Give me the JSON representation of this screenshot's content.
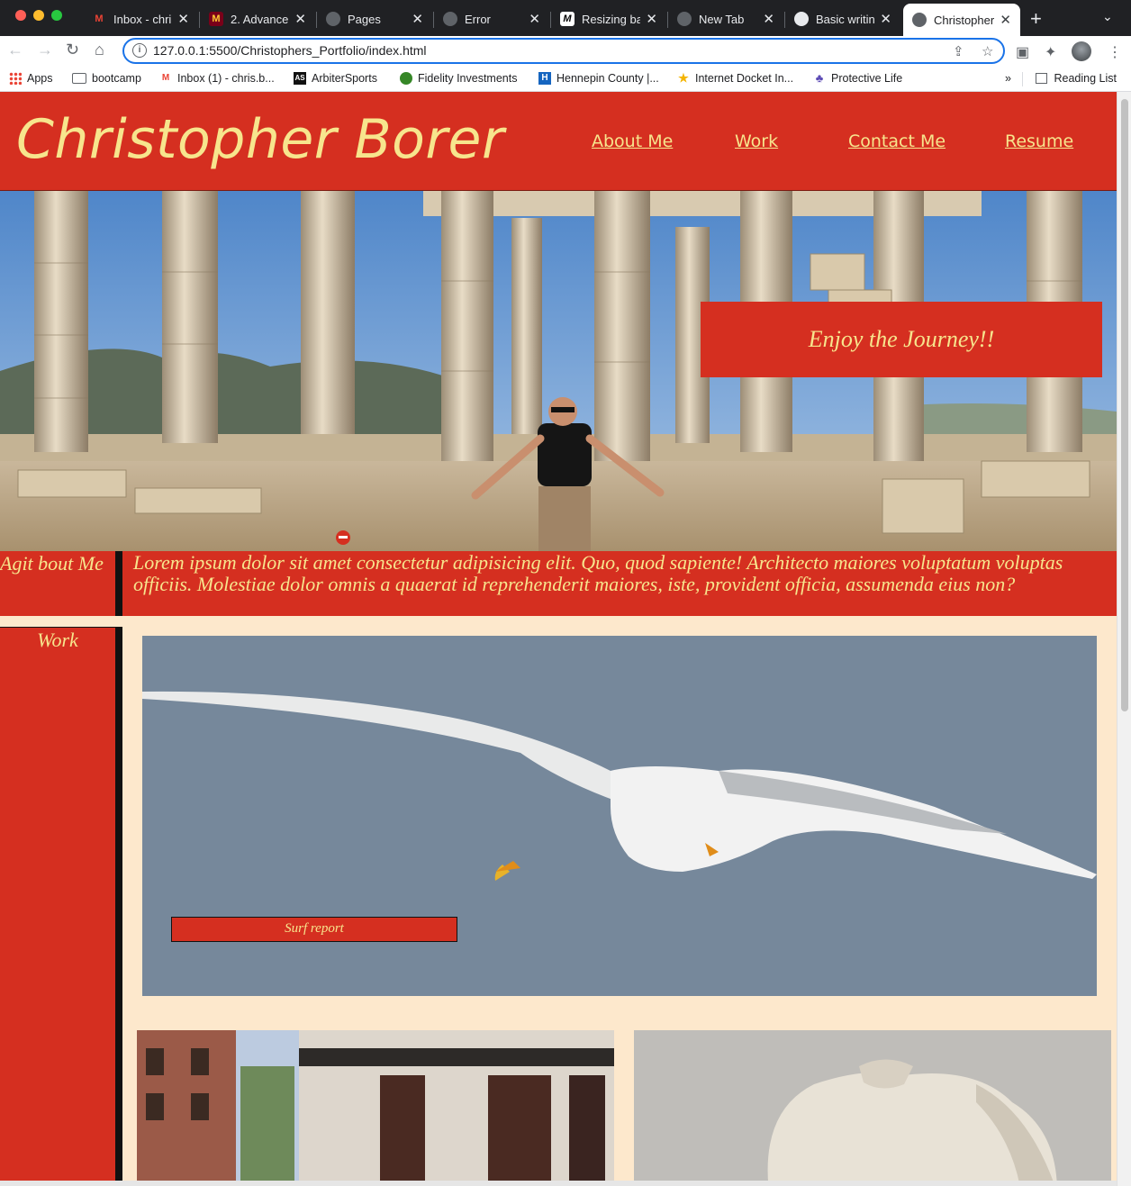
{
  "browser": {
    "tabs": [
      {
        "title": "Inbox - chri",
        "favicon": "gmail-icon",
        "active": false
      },
      {
        "title": "2. Advance",
        "favicon": "umn-icon",
        "active": false
      },
      {
        "title": "Pages",
        "favicon": "github-icon",
        "active": false
      },
      {
        "title": "Error",
        "favicon": "globe-icon",
        "active": false
      },
      {
        "title": "Resizing ba",
        "favicon": "medium-icon",
        "active": false
      },
      {
        "title": "New Tab",
        "favicon": "globe-icon",
        "active": false
      },
      {
        "title": "Basic writin",
        "favicon": "github-icon",
        "active": false
      },
      {
        "title": "Christopher",
        "favicon": "globe-icon",
        "active": true
      }
    ],
    "url": "127.0.0.1:5500/Christophers_Portfolio/index.html",
    "bookmarks": [
      {
        "label": "Apps",
        "icon": "apps-grid-icon"
      },
      {
        "label": "bootcamp",
        "icon": "folder-icon"
      },
      {
        "label": "Inbox (1) - chris.b...",
        "icon": "gmail-icon"
      },
      {
        "label": "ArbiterSports",
        "icon": "arbiter-icon"
      },
      {
        "label": "Fidelity Investments",
        "icon": "fidelity-icon"
      },
      {
        "label": "Hennepin County |...",
        "icon": "hennepin-icon"
      },
      {
        "label": "Internet Docket In...",
        "icon": "star-icon"
      },
      {
        "label": "Protective Life",
        "icon": "protective-icon"
      }
    ],
    "overflow_label": "»",
    "reading_list": "Reading List"
  },
  "site": {
    "name": "Christopher Borer",
    "nav": [
      "About Me",
      "Work",
      "Contact Me",
      "Resume"
    ],
    "hero_tagline": "Enjoy the Journey!!",
    "about_label": "Agit bout Me",
    "about_text": "Lorem ipsum dolor sit amet consectetur adipisicing elit. Quo, quod sapiente! Architecto maiores voluptatum voluptas officiis. Molestiae dolor omnis a quaerat id reprehenderit maiores, iste, provident officia, assumenda eius non?",
    "work_label": "Work",
    "feature_caption": "Surf report"
  },
  "colors": {
    "brand_red": "#d52f20",
    "brand_yellow": "#f7e58d",
    "page_bg": "#fde8cc"
  }
}
